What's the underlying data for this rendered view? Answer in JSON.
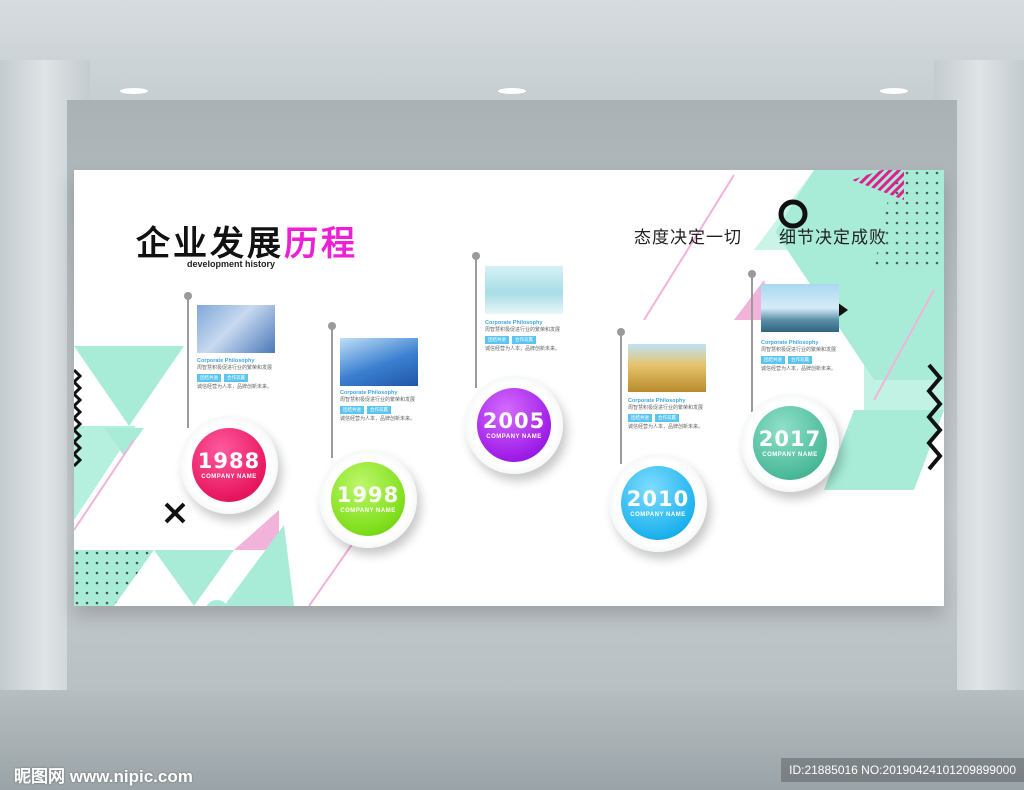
{
  "board": {
    "title_main": "企业发展",
    "title_accent": "历程",
    "subtitle": "development history",
    "slogan_left": "态度决定一切",
    "slogan_right": "细节决定成败"
  },
  "colors": {
    "mint": "#a8ecd8",
    "pink": "#f2b3da",
    "accent_magenta": "#ee1fd6",
    "tag_blue": "#5ac5f0"
  },
  "milestones": [
    {
      "year": "1988",
      "company": "COMPANY NAME",
      "photo": "handshake-city-photo",
      "heading": "Corporate Philosophy",
      "line1": "周智慧积极促进行业的繁荣和发展",
      "tag1": "团结共进",
      "tag2": "合作双赢",
      "line2": "诚信经营为人本，品牌创新未来。"
    },
    {
      "year": "1998",
      "company": "COMPANY NAME",
      "photo": "glass-building-photo",
      "heading": "Corporate Philosophy",
      "line1": "周智慧积极促进行业的繁荣和发展",
      "tag1": "团结共进",
      "tag2": "合作双赢",
      "line2": "诚信经营为人本，品牌创新未来。"
    },
    {
      "year": "2005",
      "company": "COMPANY NAME",
      "photo": "businessman-sky-photo",
      "heading": "Corporate Philosophy",
      "line1": "周智慧积极促进行业的繁荣和发展",
      "tag1": "团结共进",
      "tag2": "合作双赢",
      "line2": "诚信经营为人本，品牌创新未来。"
    },
    {
      "year": "2010",
      "company": "COMPANY NAME",
      "photo": "wheat-field-photo",
      "heading": "Corporate Philosophy",
      "line1": "周智慧积极促进行业的繁荣和发展",
      "tag1": "团结共进",
      "tag2": "合作双赢",
      "line2": "诚信经营为人本，品牌创新未来。"
    },
    {
      "year": "2017",
      "company": "COMPANY NAME",
      "photo": "skyline-photo",
      "heading": "Corporate Philosophy",
      "line1": "周智慧积极促进行业的繁荣和发展",
      "tag1": "团结共进",
      "tag2": "合作双赢",
      "line2": "诚信经营为人本，品牌创新未来。"
    }
  ],
  "watermark": {
    "left": "昵图网 www.nipic.com",
    "right": "ID:21885016 NO:20190424101209899000"
  }
}
